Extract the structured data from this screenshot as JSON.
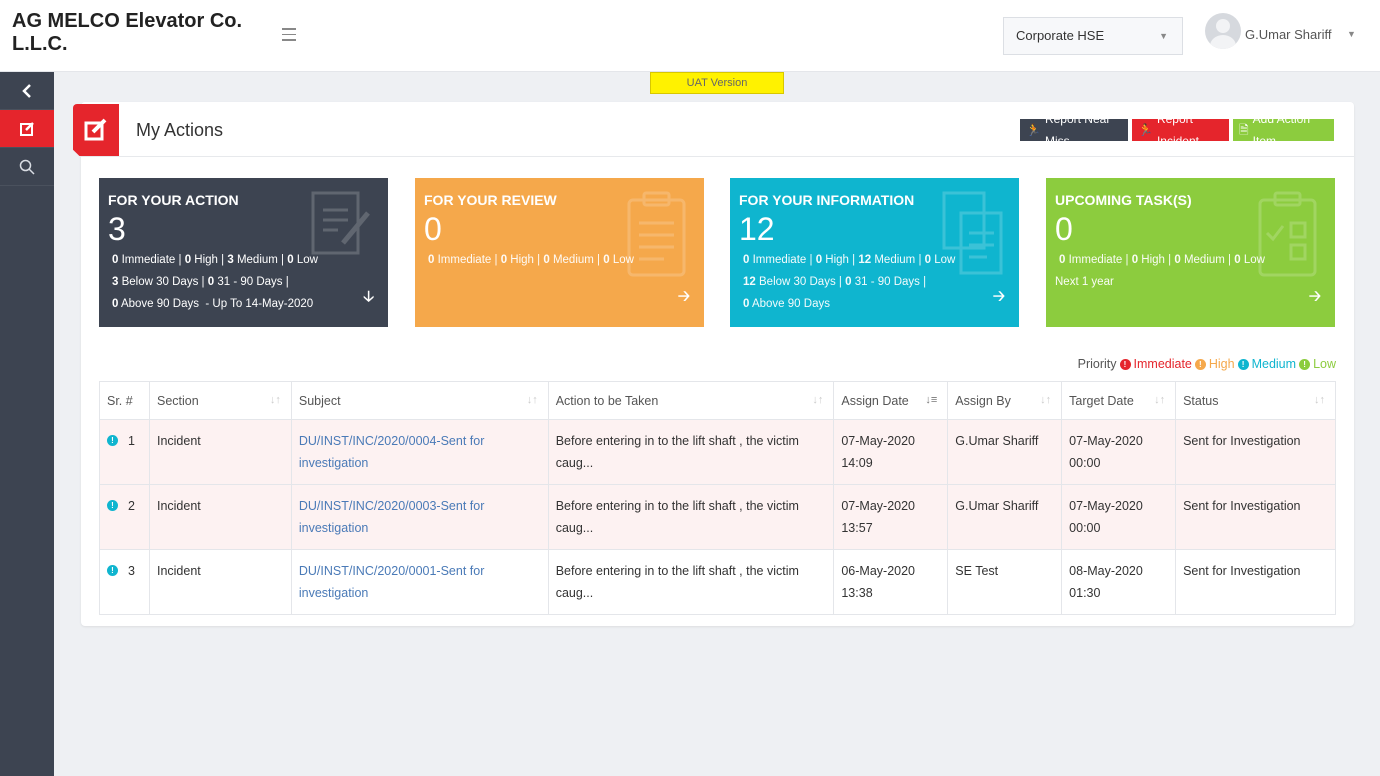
{
  "header": {
    "brand": "AG MELCO Elevator Co. L.L.C.",
    "org_select": "Corporate HSE",
    "user_name": "G.Umar Shariff"
  },
  "banner": {
    "uat": "UAT Version"
  },
  "page": {
    "title": "My Actions",
    "buttons": {
      "near_miss": "Report Near Miss",
      "incident": "Report Incident",
      "add_action": "Add Action Item"
    }
  },
  "cards": {
    "action": {
      "title": "FOR YOUR ACTION",
      "count": "3",
      "immediate": "0",
      "high": "0",
      "medium": "3",
      "low": "0",
      "below30": "3",
      "d31_90": "0",
      "above90": "0",
      "upto": "- Up To 14-May-2020"
    },
    "review": {
      "title": "FOR YOUR REVIEW",
      "count": "0",
      "immediate": "0",
      "high": "0",
      "medium": "0",
      "low": "0"
    },
    "info": {
      "title": "FOR YOUR INFORMATION",
      "count": "12",
      "immediate": "0",
      "high": "0",
      "medium": "12",
      "low": "0",
      "below30": "12",
      "d31_90": "0",
      "above90": "0"
    },
    "tasks": {
      "title": "UPCOMING TASK(S)",
      "count": "0",
      "immediate": "0",
      "high": "0",
      "medium": "0",
      "low": "0",
      "next": "Next 1 year"
    },
    "labels": {
      "immediate": "Immediate",
      "high": "High",
      "medium": "Medium",
      "low": "Low",
      "below30": "Below 30 Days",
      "d31_90": "31 - 90 Days",
      "above90": "Above 90 Days"
    }
  },
  "legend": {
    "label": "Priority",
    "immediate": "Immediate",
    "high": "High",
    "medium": "Medium",
    "low": "Low"
  },
  "table": {
    "headers": [
      "Sr. #",
      "Section",
      "Subject",
      "Action to be Taken",
      "Assign Date",
      "Assign By",
      "Target Date",
      "Status"
    ],
    "rows": [
      {
        "sr": "1",
        "section": "Incident",
        "subject": "DU/INST/INC/2020/0004-Sent for investigation",
        "action": "Before entering in to the lift shaft , the victim caug...",
        "assign_date": "07-May-2020",
        "assign_time": "14:09",
        "assign_by": "G.Umar Shariff",
        "target_date": "07-May-2020",
        "target_time": "00:00",
        "status": "Sent for Investigation"
      },
      {
        "sr": "2",
        "section": "Incident",
        "subject": "DU/INST/INC/2020/0003-Sent for investigation",
        "action": "Before entering in to the lift shaft , the victim caug...",
        "assign_date": "07-May-2020",
        "assign_time": "13:57",
        "assign_by": "G.Umar Shariff",
        "target_date": "07-May-2020",
        "target_time": "00:00",
        "status": "Sent for Investigation"
      },
      {
        "sr": "3",
        "section": "Incident",
        "subject": "DU/INST/INC/2020/0001-Sent for investigation",
        "action": "Before entering in to the lift shaft , the victim caug...",
        "assign_date": "06-May-2020",
        "assign_time": "13:38",
        "assign_by": "SE Test",
        "target_date": "08-May-2020",
        "target_time": "01:30",
        "status": "Sent for Investigation"
      }
    ]
  },
  "colors": {
    "brand_red": "#e5252c",
    "dark": "#3d4451",
    "orange": "#f5a84b",
    "cyan": "#0fb5cf",
    "green": "#8ccc3e",
    "link": "#4a7ab7"
  }
}
